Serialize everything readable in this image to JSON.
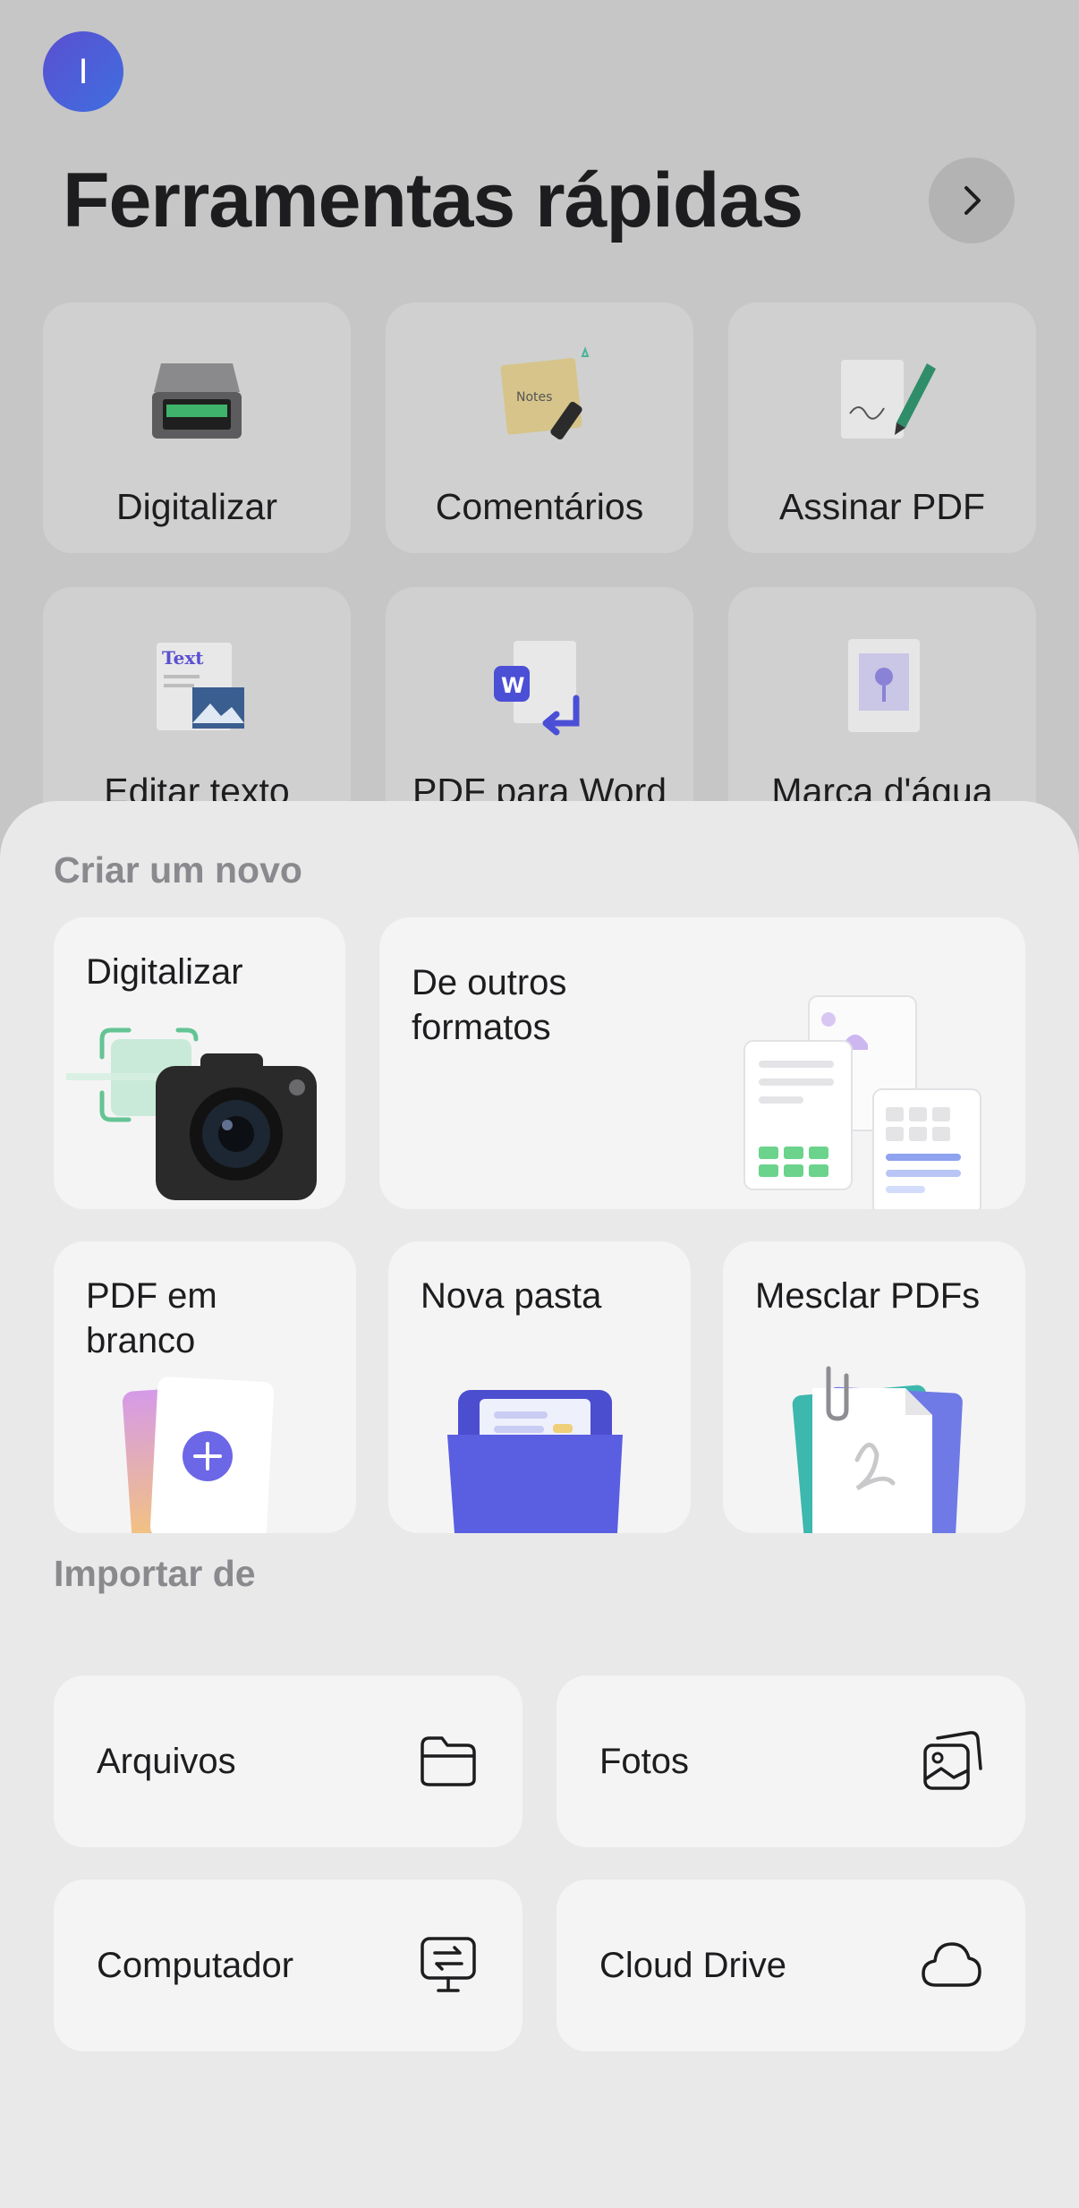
{
  "header": {
    "avatar_initial": "I",
    "title": "Ferramentas rápidas"
  },
  "quick_tools": [
    {
      "label": "Digitalizar",
      "icon": "scanner-icon"
    },
    {
      "label": "Comentários",
      "icon": "sticky-note-icon"
    },
    {
      "label": "Assinar PDF",
      "icon": "signature-pen-icon"
    },
    {
      "label": "Editar texto",
      "icon": "edit-text-icon"
    },
    {
      "label": "PDF para Word",
      "icon": "pdf-to-word-icon"
    },
    {
      "label": "Marca d'água",
      "icon": "watermark-icon"
    }
  ],
  "sheet": {
    "create_title": "Criar um novo",
    "create": {
      "scan": "Digitalizar",
      "other_formats": "De outros formatos",
      "blank_pdf": "PDF em branco",
      "new_folder": "Nova pasta",
      "merge_pdfs": "Mesclar PDFs"
    },
    "import_title": "Importar de",
    "import": [
      {
        "label": "Arquivos",
        "icon": "folder-icon"
      },
      {
        "label": "Fotos",
        "icon": "photos-icon"
      },
      {
        "label": "Computador",
        "icon": "computer-transfer-icon"
      },
      {
        "label": "Cloud Drive",
        "icon": "cloud-icon"
      }
    ]
  },
  "colors": {
    "accent": "#5b5bd6",
    "sheet_bg": "#e9e9ea",
    "card_bg": "#f4f4f5",
    "dim_bg": "#c6c6c6"
  }
}
